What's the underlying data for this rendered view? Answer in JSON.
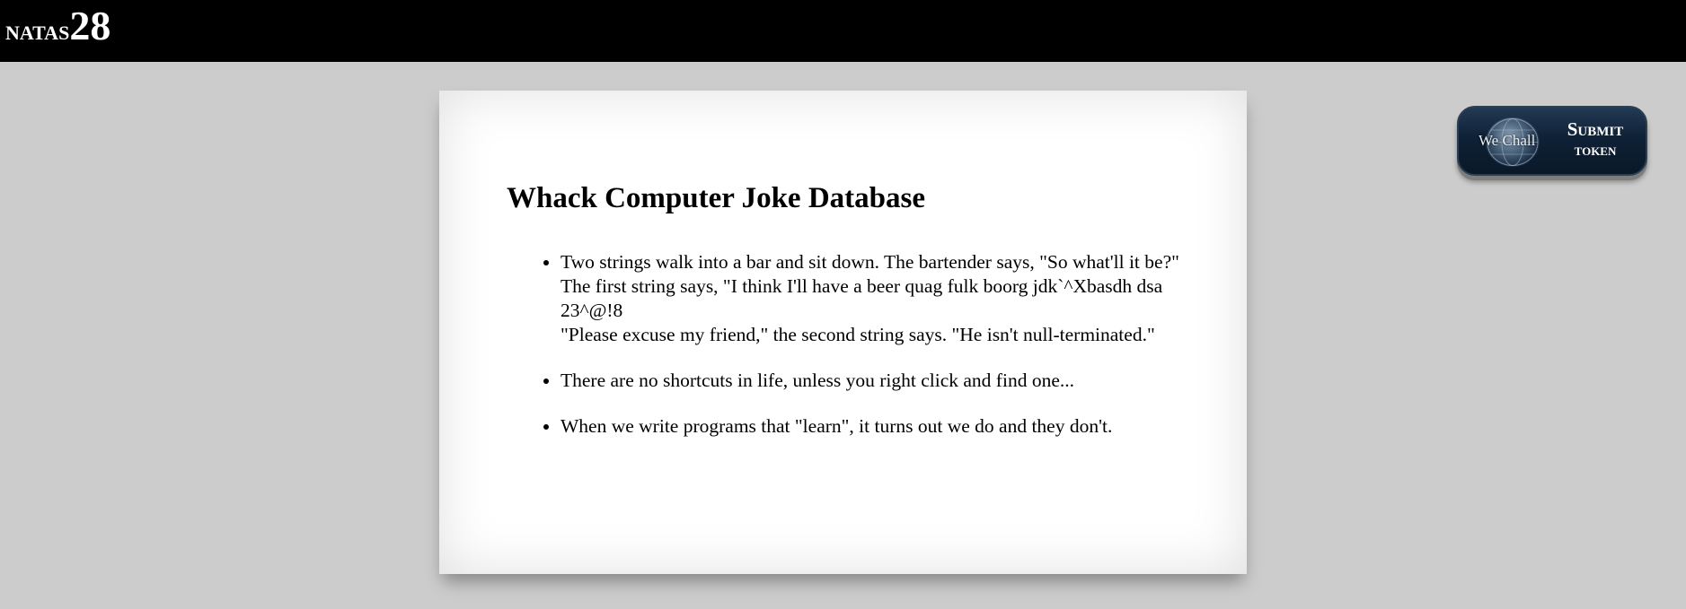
{
  "header": {
    "logo_name": "natas",
    "logo_number": "28"
  },
  "main": {
    "title": "Whack Computer Joke Database",
    "jokes": [
      {
        "lines": [
          "Two strings walk into a bar and sit down. The bartender says, \"So what'll it be?\"",
          "The first string says, \"I think I'll have a beer quag fulk boorg jdk`^Xbasdh dsa 23^@!8",
          "\"Please excuse my friend,\" the second string says. \"He isn't null-terminated.\""
        ]
      },
      {
        "lines": [
          "There are no shortcuts in life, unless you right click and find one..."
        ]
      },
      {
        "lines": [
          "When we write programs that \"learn\", it turns out we do and they don't."
        ]
      }
    ]
  },
  "wechall": {
    "logo_text": "We Chall",
    "submit_line1": "Submit",
    "submit_line2": "token",
    "globe_icon": "globe-icon"
  },
  "colors": {
    "background": "#cccccc",
    "header": "#000000",
    "panel": "#ffffff",
    "button": "#0f2136"
  }
}
